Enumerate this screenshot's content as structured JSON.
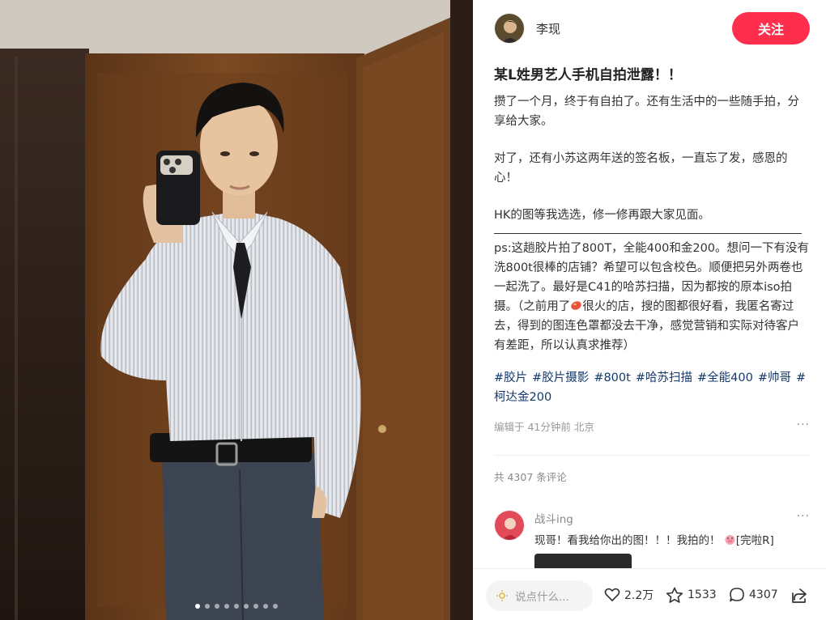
{
  "author": {
    "name": "李现"
  },
  "follow_button": "关注",
  "post": {
    "title": "某L姓男艺人手机自拍泄露！！",
    "paragraphs": [
      "攒了一个月，终于有自拍了。还有生活中的一些随手拍，分享给大家。",
      "对了，还有小苏这两年送的签名板，一直忘了发，感恩的心！",
      "HK的图等我选选，修一修再跟大家见面。"
    ],
    "ps_before": "ps:这趟胶片拍了800T，全能400和金200。想问一下有没有洗800t很棒的店铺？希望可以包含校色。顺便把另外两卷也一起洗了。最好是C41的哈苏扫描，因为都按的原本iso拍摄。（之前用了",
    "ps_after": "很火的店，搜的图都很好看，我匿名寄过去，得到的图连色罩都没去干净，感觉营销和实际对待客户有差距，所以认真求推荐）",
    "tags": [
      "#胶片",
      "#胶片摄影",
      "#800t",
      "#哈苏扫描",
      "#全能400",
      "#帅哥",
      "#柯达金200"
    ],
    "meta": "编辑于 41分钟前 北京",
    "comment_count": "共 4307 条评论"
  },
  "comment": {
    "author": "战斗ing",
    "text": "现哥！看我给你出的图！！！我拍的！",
    "sticker_text": "[完啦R]"
  },
  "bottom_bar": {
    "input_placeholder": "说点什么...",
    "likes": "2.2万",
    "stars": "1533",
    "comments": "4307"
  },
  "icons": [
    "like-heart-icon",
    "star-icon",
    "comment-bubble-icon",
    "share-icon",
    "more-dots-icon"
  ],
  "colors": {
    "accent": "#ff2e4d",
    "tag": "#13386c"
  },
  "gallery": {
    "image_count": 9,
    "active_index": 0
  }
}
